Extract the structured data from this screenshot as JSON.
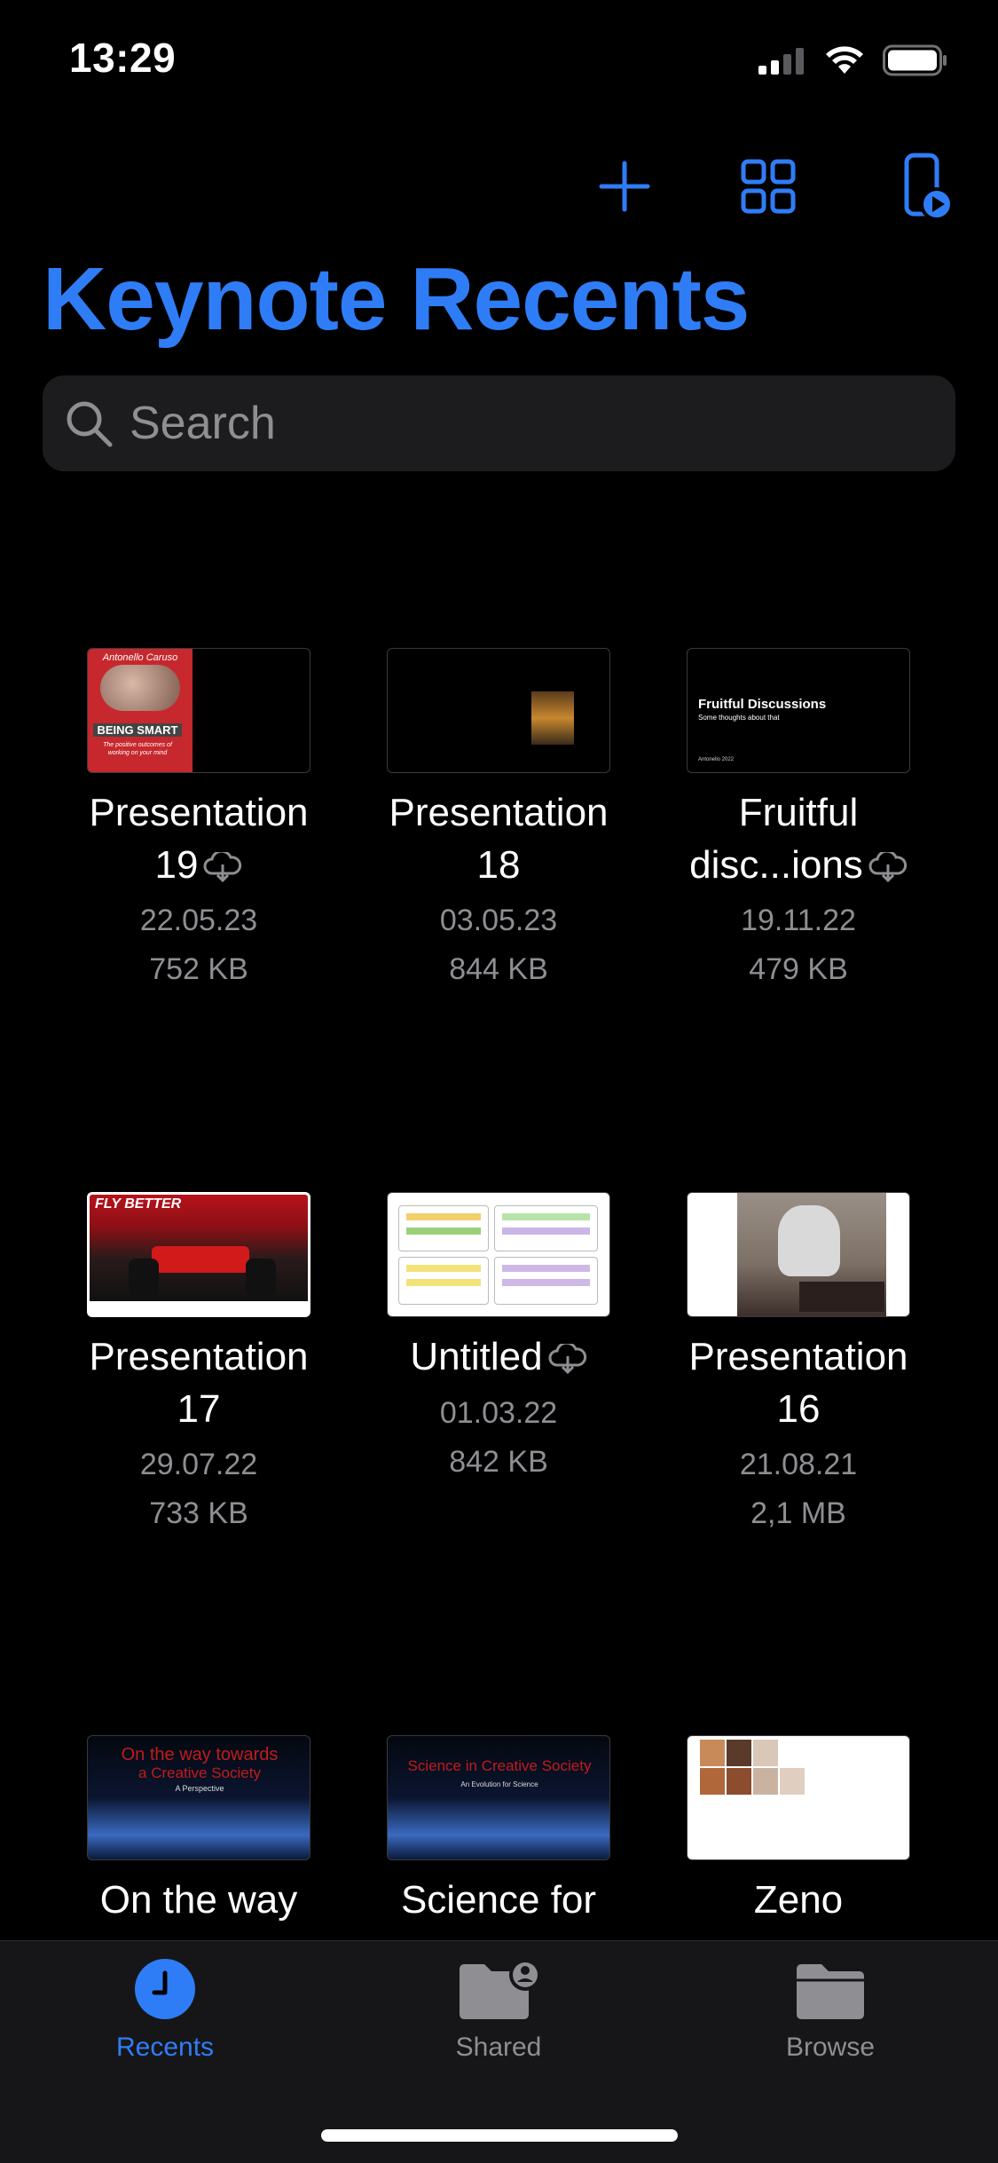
{
  "status": {
    "time": "13:29"
  },
  "toolbar": {
    "add_icon": "plus-icon",
    "grid_icon": "grid-view-icon",
    "play_icon": "play-on-device-icon"
  },
  "title": "Keynote Recents",
  "search": {
    "placeholder": "Search"
  },
  "files": [
    {
      "name_line1": "Presentation",
      "name_line2": "19",
      "cloud": true,
      "date": "22.05.23",
      "size": "752 KB",
      "thumb_text": "Antonello Caruso",
      "thumb_title": "BEING SMART",
      "thumb_sub": "The positive outcomes of working on your mind"
    },
    {
      "name_line1": "Presentation",
      "name_line2": "18",
      "cloud": false,
      "date": "03.05.23",
      "size": "844 KB"
    },
    {
      "name_line1": "Fruitful",
      "name_line2": "disc...ions",
      "cloud": true,
      "date": "19.11.22",
      "size": "479 KB",
      "thumb_title": "Fruitful Discussions",
      "thumb_sub": "Some thoughts about that",
      "thumb_footer": "Antonello 2022"
    },
    {
      "name_line1": "Presentation",
      "name_line2": "17",
      "cloud": false,
      "date": "29.07.22",
      "size": "733 KB",
      "thumb_text": "FLY BETTER"
    },
    {
      "name_line1": "Untitled",
      "name_line2": "",
      "cloud": true,
      "date": "01.03.22",
      "size": "842 KB"
    },
    {
      "name_line1": "Presentation",
      "name_line2": "16",
      "cloud": false,
      "date": "21.08.21",
      "size": "2,1 MB"
    },
    {
      "name_line1": "On the way",
      "thumb_title": "On the way towards",
      "thumb_title2": "a Creative Society",
      "thumb_sub": "A Perspective"
    },
    {
      "name_line1": "Science for",
      "thumb_title": "Science in Creative Society",
      "thumb_sub": "An Evolution for Science"
    },
    {
      "name_line1": "Zeno"
    }
  ],
  "tabs": [
    {
      "label": "Recents",
      "icon": "clock-icon",
      "active": true
    },
    {
      "label": "Shared",
      "icon": "shared-folder-icon",
      "active": false
    },
    {
      "label": "Browse",
      "icon": "folder-icon",
      "active": false
    }
  ],
  "colors": {
    "accent": "#2f7df6",
    "secondary_text": "#8e8e93",
    "tab_inactive": "#8e8e93"
  }
}
